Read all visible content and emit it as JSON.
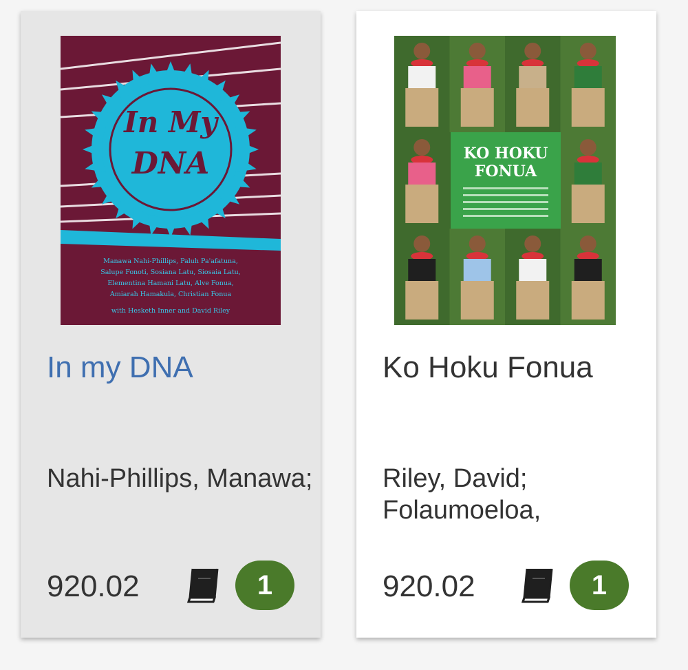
{
  "items": [
    {
      "title": "In my DNA",
      "authors": "Nahi-Phillips, Manawa;",
      "call_number": "920.02",
      "count": "1",
      "icon": "book-icon",
      "cover": {
        "title_line1": "In My",
        "title_line2": "DNA",
        "credits": [
          "Manawa Nahi-Phillips, Paluh Pa'afatuna,",
          "Salupe Fonoti, Sosiana Latu, Siosaia Latu,",
          "Elementina Hamani Latu, Alve Fonua,",
          "Amiarah Hamakula, Christian Fonua",
          "with Hesketh Inner and David Riley"
        ]
      }
    },
    {
      "title": "Ko Hoku Fonua",
      "authors": "Riley, David; Folaumoeloa,",
      "call_number": "920.02",
      "count": "1",
      "icon": "book-icon",
      "cover": {
        "title_line1": "KO HOKU",
        "title_line2": "FONUA"
      }
    }
  ],
  "colors": {
    "badge": "#4a7a2a",
    "link_title": "#3f6fb0",
    "card_hover": "#e6e6e6",
    "dna_cover_bg": "#6b1836",
    "dna_cover_accent": "#1fb7d9",
    "fonua_cover_panel": "#3aa34a"
  }
}
